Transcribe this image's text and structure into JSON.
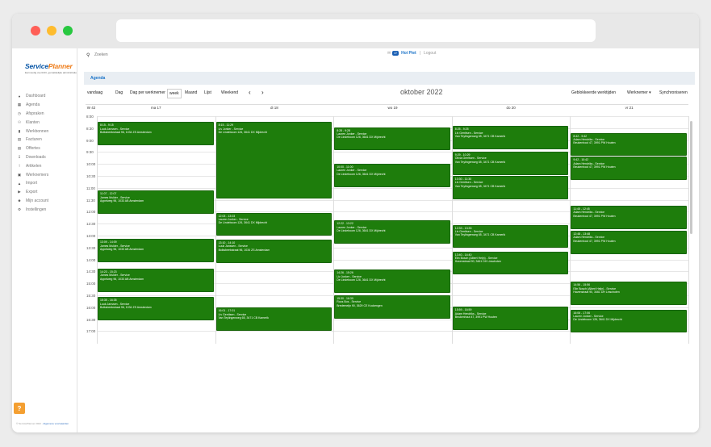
{
  "logo": {
    "main": "Service",
    "accent": "Planner",
    "tagline": "Eenvoudig overzicht, gemakkelijke administratie"
  },
  "nav": [
    {
      "label": "Dashboard",
      "icon": "dashboard-icon"
    },
    {
      "label": "Agenda",
      "icon": "calendar-icon"
    },
    {
      "label": "Afspraken",
      "icon": "clock-icon"
    },
    {
      "label": "Klanten",
      "icon": "users-icon"
    },
    {
      "label": "Werkbonnen",
      "icon": "truck-icon"
    },
    {
      "label": "Facturen",
      "icon": "invoice-icon"
    },
    {
      "label": "Offertes",
      "icon": "document-icon"
    },
    {
      "label": "Downloads",
      "icon": "download-icon"
    },
    {
      "label": "Artikelen",
      "icon": "tools-icon"
    },
    {
      "label": "Werknemers",
      "icon": "id-card-icon"
    },
    {
      "label": "Import",
      "icon": "import-icon"
    },
    {
      "label": "Export",
      "icon": "export-icon"
    },
    {
      "label": "Mijn account",
      "icon": "user-icon"
    },
    {
      "label": "Instellingen",
      "icon": "gear-icon"
    }
  ],
  "help_label": "?",
  "copyright": {
    "text": "© ServicePlanner 2022 - ",
    "link": "Algemene voorwaarden"
  },
  "search": {
    "placeholder": "Zoeken"
  },
  "topbar": {
    "notifications": "37",
    "user": "Hoi Piet",
    "separator": "|",
    "logout": "Logout"
  },
  "breadcrumb": "Agenda",
  "toolbar": {
    "today": "vandaag",
    "day": "Dag",
    "day_per_employee": "Dag per werknemer",
    "week": "week",
    "month": "Maand",
    "list": "Lijst",
    "weekend": "Weekend",
    "prev": "‹",
    "next": "›",
    "title": "oktober 2022",
    "blocked": "Geblokkeerde werktijden",
    "employee": "Werknemer ▾",
    "sync": "Synchroniseren"
  },
  "calendar": {
    "week_label": "W 42",
    "days": [
      "ma 17",
      "di 18",
      "wo 19",
      "do 20",
      "vr 21"
    ],
    "times": [
      "8:00",
      "8:30",
      "9:00",
      "9:30",
      "10:00",
      "10:30",
      "11:00",
      "11:30",
      "12:00",
      "12:30",
      "13:00",
      "13:30",
      "14:00",
      "14:30",
      "15:00",
      "15:30",
      "16:00",
      "16:30",
      "17:00"
    ],
    "events": [
      {
        "day": 0,
        "start": "8:15",
        "end": "9:15",
        "time": "8:15 - 9:15",
        "title": "Luuk Janssen - Service",
        "address": "Bolksbeekstraat 96, 1034 ZS Amsterdam"
      },
      {
        "day": 0,
        "start": "11:07",
        "end": "12:07",
        "time": "11:07 - 12:07",
        "title": "James Mulder - Service",
        "address": "Appelweg 96, 1033 AB Amsterdam"
      },
      {
        "day": 0,
        "start": "13:09",
        "end": "14:09",
        "time": "13:09 - 14:09",
        "title": "James Mulder - Service",
        "address": "Appelweg 96, 1033 AB Amsterdam"
      },
      {
        "day": 0,
        "start": "14:23",
        "end": "15:23",
        "time": "14:23 - 15:23",
        "title": "James Mulder - Service",
        "address": "Appelweg 96, 1033 AB Amsterdam"
      },
      {
        "day": 0,
        "start": "15:35",
        "end": "16:35",
        "time": "15:35 - 16:35",
        "title": "Luuk Janssen - Service",
        "address": "Bolksbeekstraat 96, 1034 ZS Amsterdam"
      },
      {
        "day": 1,
        "start": "8:15",
        "end": "11:29",
        "time": "8:15 - 11:29",
        "title": "Liv Jonker - Service",
        "address": "De Lindeboom 126, 3641 DX Mijdrecht"
      },
      {
        "day": 1,
        "start": "12:03",
        "end": "13:03",
        "time": "12:03 - 13:03",
        "title": "Lauren Jonker - Service",
        "address": "De Lindeboom 126, 3641 DX Mijdrecht"
      },
      {
        "day": 1,
        "start": "13:10",
        "end": "14:10",
        "time": "13:10 - 14:10",
        "title": "Luuk Janssen - Service",
        "address": "Bolksbeekstraat 96, 1034 ZS Amsterdam"
      },
      {
        "day": 1,
        "start": "16:01",
        "end": "17:01",
        "time": "16:01 - 17:01",
        "title": "Liv Gerritsen - Service",
        "address": "Van Teylingenweg 65, 3471 CB Kamerik"
      },
      {
        "day": 2,
        "start": "8:28",
        "end": "9:28",
        "time": "8:28 - 9:28",
        "title": "Lauren Jonker - Service",
        "address": "De Lindeboom 126, 3641 DX Mijdrecht"
      },
      {
        "day": 2,
        "start": "10:00",
        "end": "11:00",
        "time": "10:00 - 11:00",
        "title": "Lauren Jonker - Service",
        "address": "De Lindeboom 126, 3641 DX Mijdrecht"
      },
      {
        "day": 2,
        "start": "12:22",
        "end": "13:22",
        "time": "12:22 - 13:22",
        "title": "Lauren Jonker - Service",
        "address": "De Lindeboom 126, 3641 DX Mijdrecht"
      },
      {
        "day": 2,
        "start": "14:26",
        "end": "15:26",
        "time": "14:26 - 15:26",
        "title": "Liv Jonker - Service",
        "address": "De Lindeboom 126, 3641 DX Mijdrecht"
      },
      {
        "day": 2,
        "start": "15:30",
        "end": "16:30",
        "time": "15:30 - 16:30",
        "title": "Roos Bos - Service",
        "address": "Bredemeijn 90, 3629 CE Kockengen"
      },
      {
        "day": 3,
        "start": "8:25",
        "end": "9:25",
        "time": "8:25 - 9:25",
        "title": "Liv Gerritsen - Service",
        "address": "Van Teylingenweg 65, 3471 CB Kamerik"
      },
      {
        "day": 3,
        "start": "9:29",
        "end": "10:29",
        "time": "9:29 - 10:29",
        "title": "Olivia Gerritsen - Service",
        "address": "Van Teylingenweg 65, 3471 CB Kamerik"
      },
      {
        "day": 3,
        "start": "10:30",
        "end": "11:30",
        "time": "10:30 - 11:30",
        "title": "Liv Gerritsen - Service",
        "address": "Van Teylingenweg 65, 3471 CB Kamerik"
      },
      {
        "day": 3,
        "start": "12:33",
        "end": "13:33",
        "time": "12:33 - 13:33",
        "title": "Liv Gerritsen - Service",
        "address": "Van Teylingenweg 65, 3471 CB Kamerik"
      },
      {
        "day": 3,
        "start": "13:40",
        "end": "14:40",
        "time": "13:40 - 14:40",
        "title": "Elin Bosch (Albert Heijn) - Service",
        "address": "Havenstraat 90, 3461 DH Linschoten"
      },
      {
        "day": 3,
        "start": "15:59",
        "end": "16:59",
        "time": "15:59 - 16:59",
        "title": "Adam Hendriks - Service",
        "address": "Beukenhout 47, 3991 PW Houten"
      },
      {
        "day": 4,
        "start": "8:42",
        "end": "9:42",
        "time": "8:42 - 9:42",
        "title": "Adam Hendriks - Service",
        "address": "Beukenhout 47, 3991 PW Houten"
      },
      {
        "day": 4,
        "start": "9:42",
        "end": "10:42",
        "time": "9:42 - 10:42",
        "title": "Adam Hendriks - Service",
        "address": "Beukenhout 47, 3991 PW Houten"
      },
      {
        "day": 4,
        "start": "11:45",
        "end": "12:45",
        "time": "11:45 - 12:45",
        "title": "Adam Hendriks - Service",
        "address": "Beukenhout 47, 3991 PW Houten"
      },
      {
        "day": 4,
        "start": "12:48",
        "end": "13:48",
        "time": "12:48 - 13:48",
        "title": "Adam Hendriks - Service",
        "address": "Beukenhout 47, 3991 PW Houten"
      },
      {
        "day": 4,
        "start": "14:56",
        "end": "15:56",
        "time": "14:56 - 15:56",
        "title": "Elin Bosch (Albert Heijn) - Service",
        "address": "Havenstraat 90, 3461 DH Linschoten"
      },
      {
        "day": 4,
        "start": "16:06",
        "end": "17:06",
        "time": "16:06 - 17:06",
        "title": "Lauren Jonker - Service",
        "address": "De Lindeboom 126, 3641 DX Mijdrecht"
      }
    ]
  },
  "colors": {
    "event_bg": "#1e7d0c",
    "brand_blue": "#0b58a8",
    "brand_orange": "#ee7d1b",
    "accent_blue": "#1a73c8"
  }
}
